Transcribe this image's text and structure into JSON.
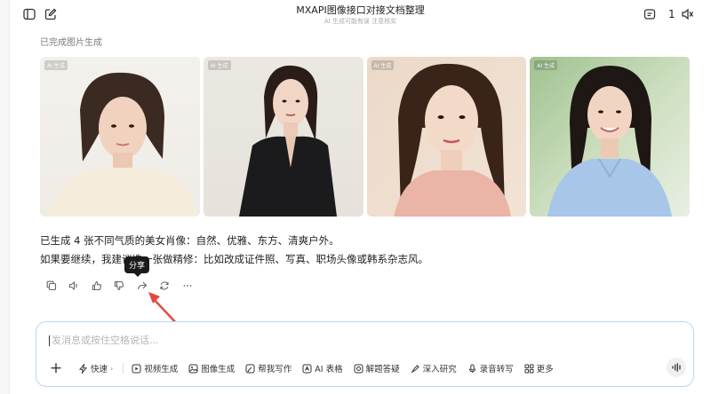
{
  "header": {
    "title": "MXAPI图像接口对接文档整理",
    "subtitle": "AI 生成可能有误 注意核实",
    "count": "1"
  },
  "status_text": "已完成图片生成",
  "images": [
    {
      "tag": "AI 生成"
    },
    {
      "tag": "AI 生成"
    },
    {
      "tag": "AI 生成"
    },
    {
      "tag": "AI 生成"
    }
  ],
  "message": {
    "line1": "已生成 4 张不同气质的美女肖像：自然、优雅、东方、清爽户外。",
    "line2": "如果要继续，我建议选一张做精修：比如改成证件照、写真、职场头像或韩系杂志风。"
  },
  "tooltip": "分享",
  "composer": {
    "placeholder": "发消息或按住空格说话...",
    "plus": "+",
    "tools": [
      {
        "name": "fast",
        "label": "快速",
        "icon": "bolt-icon"
      },
      {
        "name": "video",
        "label": "视频生成",
        "icon": "video-icon"
      },
      {
        "name": "image",
        "label": "图像生成",
        "icon": "image-icon"
      },
      {
        "name": "write",
        "label": "帮我写作",
        "icon": "pen-icon"
      },
      {
        "name": "table",
        "label": "AI 表格",
        "icon": "table-icon"
      },
      {
        "name": "qa",
        "label": "解题答疑",
        "icon": "question-icon"
      },
      {
        "name": "research",
        "label": "深入研究",
        "icon": "rocket-icon"
      },
      {
        "name": "transcribe",
        "label": "录音转写",
        "icon": "mic-icon"
      },
      {
        "name": "more",
        "label": "更多",
        "icon": "grid-icon"
      }
    ]
  },
  "colors": {
    "accent_border": "#b9d7f5",
    "arrow": "#e8473f"
  }
}
